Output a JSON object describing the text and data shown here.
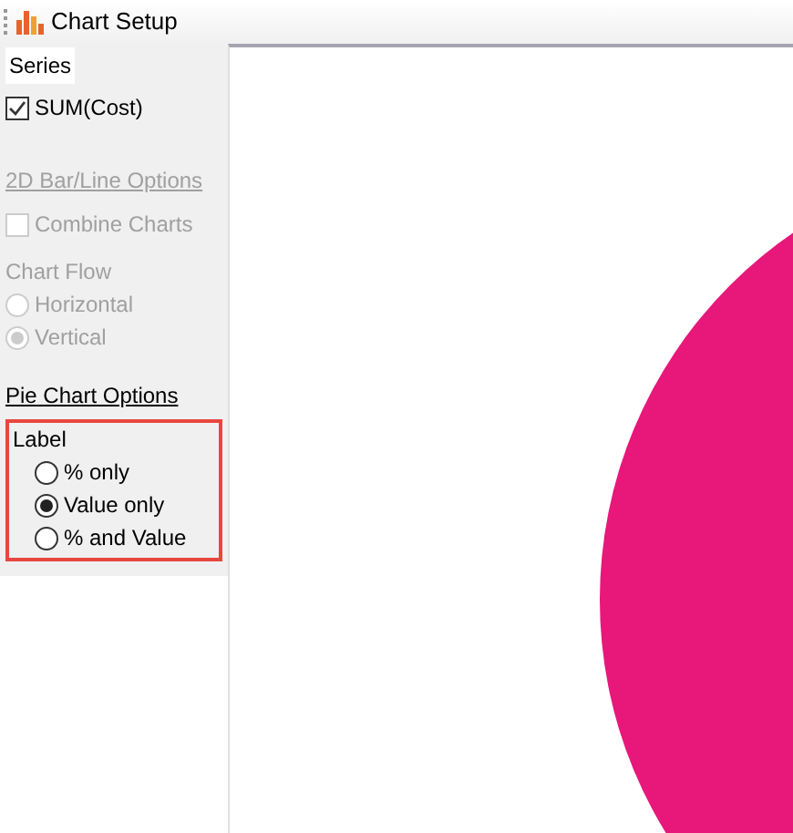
{
  "window": {
    "title": "Chart Setup"
  },
  "series": {
    "heading": "Series",
    "items": [
      {
        "label": "SUM(Cost)",
        "checked": true
      }
    ]
  },
  "bar_line_options": {
    "heading": "2D Bar/Line Options",
    "disabled": true,
    "combine_charts": {
      "label": "Combine Charts",
      "checked": false,
      "disabled": true
    }
  },
  "chart_flow": {
    "heading": "Chart Flow",
    "disabled": true,
    "options": [
      {
        "label": "Horizontal",
        "selected": false
      },
      {
        "label": "Vertical",
        "selected": true
      }
    ]
  },
  "pie_chart_options": {
    "heading": "Pie Chart Options",
    "disabled": false
  },
  "label_group": {
    "heading": "Label",
    "highlighted": true,
    "options": [
      {
        "label": "% only",
        "selected": false
      },
      {
        "label": "Value only",
        "selected": true
      },
      {
        "label": "% and Value",
        "selected": false
      }
    ]
  },
  "chart": {
    "slices": [
      {
        "color": "#e8177a"
      }
    ]
  }
}
